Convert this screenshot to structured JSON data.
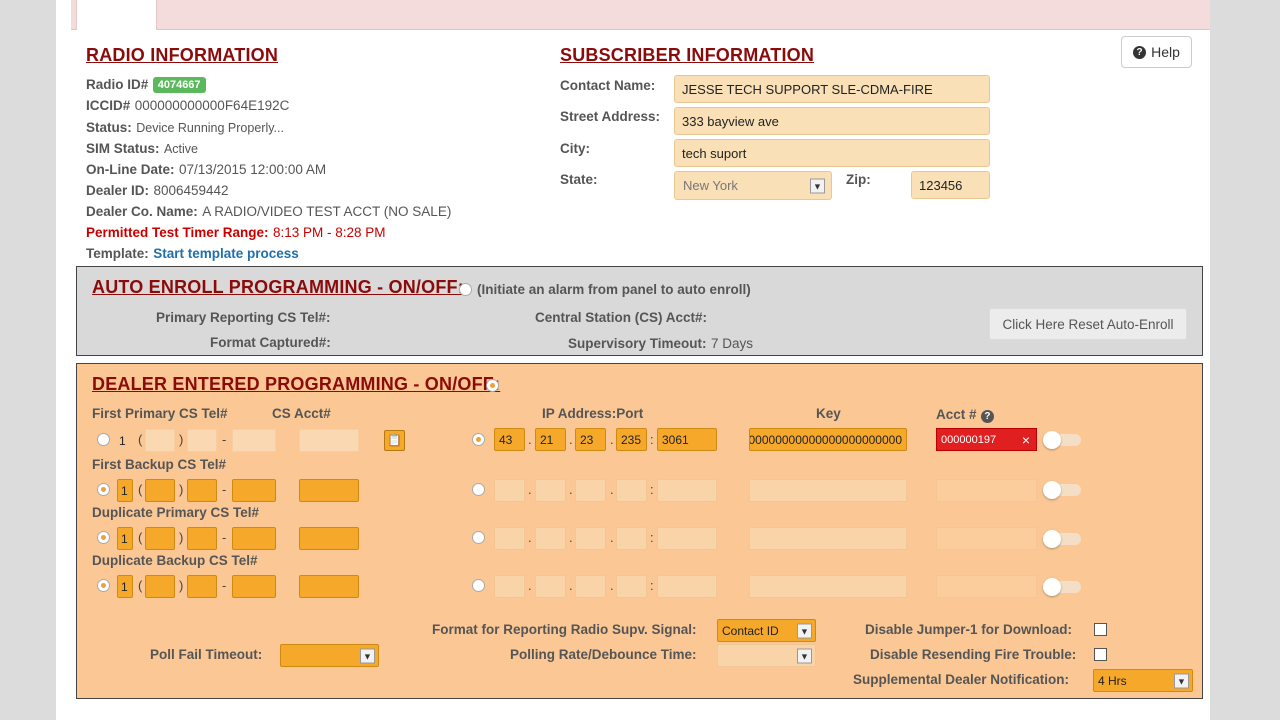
{
  "radio_info": {
    "title": "RADIO INFORMATION",
    "radio_id_label": "Radio ID#",
    "radio_id_value": "4074667",
    "iccid_label": "ICCID#",
    "iccid_value": "000000000000F64E192C",
    "status_label": "Status:",
    "status_value": "Device Running Properly...",
    "sim_label": "SIM Status:",
    "sim_value": "Active",
    "online_label": "On-Line Date:",
    "online_value": "07/13/2015 12:00:00 AM",
    "dealer_id_label": "Dealer ID:",
    "dealer_id_value": "8006459442",
    "dealer_co_label": "Dealer Co. Name:",
    "dealer_co_value": "A RADIO/VIDEO TEST ACCT (NO SALE)",
    "timer_label": "Permitted Test Timer Range:",
    "timer_value": "8:13 PM - 8:28 PM",
    "template_label": "Template:",
    "template_link": "Start template process"
  },
  "subscriber": {
    "title": "SUBSCRIBER INFORMATION",
    "contact_label": "Contact Name:",
    "contact_value": "JESSE TECH SUPPORT SLE-CDMA-FIRE",
    "street_label": "Street Address:",
    "street_value": "333 bayview ave",
    "city_label": "City:",
    "city_value": "tech suport",
    "state_label": "State:",
    "state_value": "New York",
    "zip_label": "Zip:",
    "zip_value": "123456"
  },
  "help_label": "Help",
  "auto_enroll": {
    "title": "AUTO ENROLL PROGRAMMING - ON/OFF:",
    "hint": "(Initiate an alarm from panel to auto enroll)",
    "primary_label": "Primary Reporting CS Tel#:",
    "format_label": "Format Captured#:",
    "cs_acct_label": "Central Station (CS) Acct#:",
    "supervisory_label": "Supervisory Timeout:",
    "supervisory_value": "7 Days",
    "reset_label": "Click Here Reset Auto-Enroll"
  },
  "dealer": {
    "title": "DEALER ENTERED PROGRAMMING - ON/OFF:",
    "hdr_first_primary": "First Primary CS Tel#",
    "hdr_cs_acct": "CS Acct#",
    "hdr_ip_port": "IP Address:Port",
    "hdr_key": "Key",
    "hdr_acct": "Acct #",
    "row_first_backup": "First Backup CS Tel#",
    "row_dup_primary": "Duplicate Primary CS Tel#",
    "row_dup_backup": "Duplicate Backup CS Tel#",
    "row1": {
      "country_code": "1",
      "ip1": "43",
      "ip2": "21",
      "ip3": "23",
      "ip4": "235",
      "port": "3061",
      "key": "000000000000000000000000",
      "acct": "000000197",
      "acct_clear": "×"
    },
    "row_cc": "1",
    "paren_open": "(",
    "paren_close": ")",
    "dash": "-",
    "dot": ".",
    "colon": ":",
    "format_label": "Format for Reporting Radio Supv. Signal:",
    "format_value": "Contact ID",
    "poll_fail_label": "Poll Fail Timeout:",
    "polling_rate_label": "Polling Rate/Debounce Time:",
    "disable_jumper_label": "Disable Jumper-1 for Download:",
    "disable_resend_label": "Disable Resending Fire Trouble:",
    "supp_notif_label": "Supplemental Dealer Notification:",
    "supp_notif_value": "4 Hrs"
  },
  "icons": {
    "help": "question-circle-icon",
    "dropdown": "chevron-down-icon",
    "clipboard": "clipboard-icon",
    "clear": "close-icon"
  },
  "colors": {
    "section_title": "#8b0a0a",
    "dealer_bg": "#fbc895",
    "field_active": "#f5a829",
    "badge_green": "#5cb85c",
    "error_red": "#e02020",
    "link_blue": "#1f6fae"
  }
}
